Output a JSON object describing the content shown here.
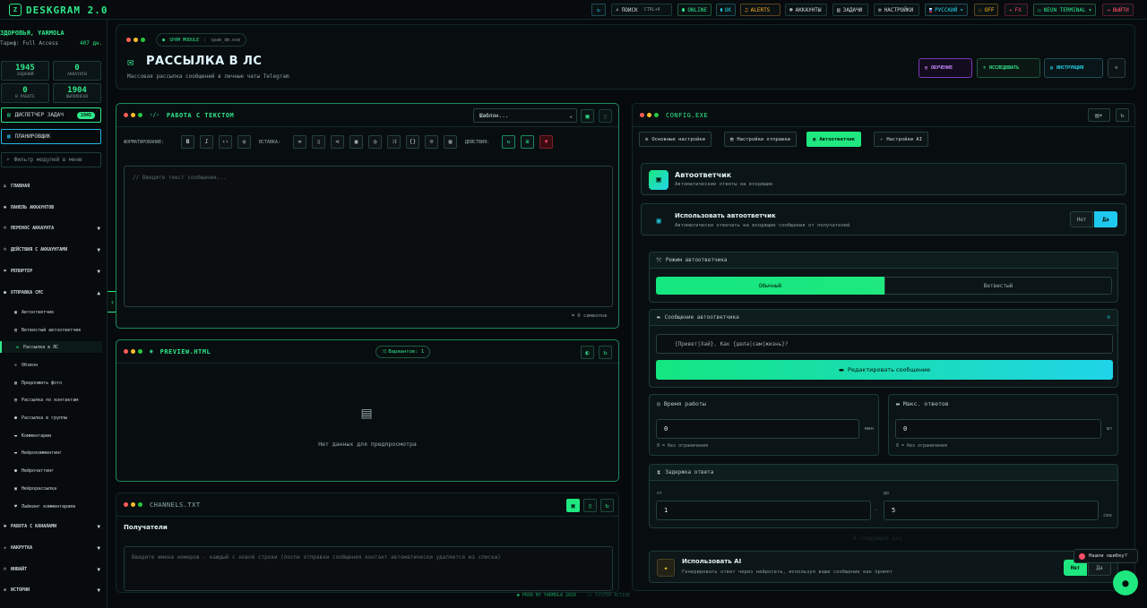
{
  "app": {
    "logo_glyph": "Z",
    "name": "DESKGRAM 2.0"
  },
  "topbar": {
    "search_label": "ПОИСК",
    "search_shortcut": "CTRL+K",
    "online_label": "ONLINE",
    "ok_label": "OK",
    "alerts_label": "ALERTS",
    "accounts_label": "АККАУНТЫ",
    "tasks_label": "ЗАДАЧИ",
    "settings_label": "НАСТРОЙКИ",
    "language_label": "РУССКИЙ",
    "off_label": "OFF",
    "fx_label": "FX",
    "theme_label": "NEON TERMINAL",
    "logout_label": "ВЫЙТИ"
  },
  "sidebar": {
    "greeting": "ЗДОРОВЬЯ, YARMOLA",
    "tariff": "Тариф: Full Access",
    "days_left": "407 дн.",
    "stats": [
      {
        "value": "1945",
        "label": "ЗАДАНИЙ"
      },
      {
        "value": "0",
        "label": "АККАУНТЫ"
      },
      {
        "value": "0",
        "label": "В РАБОТЕ"
      },
      {
        "value": "1904",
        "label": "ВЫПОЛНЕНО"
      }
    ],
    "dispatcher_label": "ДИСПЕТЧЕР ЗАДАЧ",
    "dispatcher_badge": "1945",
    "planner_label": "ПЛАНИРОВЩИК",
    "filter_placeholder": "Фильтр модулей в меню",
    "nav": [
      {
        "label": "ГЛАВНАЯ",
        "icon": "home-icon"
      },
      {
        "label": "ПАНЕЛЬ АККАУНТОВ",
        "icon": "users-icon"
      },
      {
        "label": "ПЕРЕНОС АККАУНТА",
        "icon": "user-transfer-icon"
      },
      {
        "label": "ДЕЙСТВИЯ С АККАУНТАМИ",
        "icon": "user-actions-icon"
      },
      {
        "label": "РЕПОРТЕР",
        "icon": "flag-icon"
      },
      {
        "label": "ОТПРАВКА СМС",
        "icon": "chat-icon"
      }
    ],
    "sms_items": [
      "Автоответчик",
      "Ветвистый автоответчик",
      "Рассылка в ЛС",
      "Обзвон",
      "Предложить фото",
      "Рассылка по контактам",
      "Рассылка в группы",
      "Комментарии",
      "Нейрокомментинг",
      "Нейрочаттинг",
      "Нейрорассылка",
      "Лайкинг комментариев"
    ],
    "nav_bottom": [
      {
        "label": "РАБОТА С КАНАЛАМИ",
        "icon": "channels-icon"
      },
      {
        "label": "НАКРУТКА",
        "icon": "chart-icon"
      },
      {
        "label": "ИНВАЙТ",
        "icon": "invite-icon"
      },
      {
        "label": "ИСТОРИИ",
        "icon": "stories-icon"
      }
    ]
  },
  "header": {
    "module_tag": "SPAM MODULE",
    "module_file": "spam_dm.exe",
    "title": "РАССЫЛКА В ЛС",
    "subtitle": "Массовая рассылка сообщений в личные чаты Telegram",
    "learn_label": "ОБУЧЕНИЕ",
    "research_label": "ИССЛЕДОВАТЬ",
    "guide_label": "ИНСТРУКЦИЯ"
  },
  "text_panel": {
    "title": "РАБОТА С ТЕКСТОМ",
    "template_select": "Шаблон...",
    "formatting_label": "ФОРМАТИРОВАНИЕ:",
    "insert_label": "ВСТАВКА:",
    "actions_label": "ДЕЙСТВИЯ:",
    "bold": "B",
    "italic": "I",
    "editor_placeholder": "// Введите текст сообщения...",
    "char_count": "0 символов"
  },
  "preview_panel": {
    "title": "PREVIEW.HTML",
    "variants": "Вариантов: 1",
    "empty_text": "Нет данных для предпросмотра"
  },
  "channels_panel": {
    "title": "CHANNELS.TXT",
    "recipients_label": "Получатели",
    "placeholder": "Введите имена номеров - каждый с новой строки (после отправки сообщения контакт автоматически удаляется из списка)"
  },
  "config": {
    "title": "CONFIG.EXE",
    "tabs": [
      "Основные настройки",
      "Настройки отправки",
      "Автоответчик",
      "Настройки AI"
    ],
    "active_tab": 2,
    "autoresponder_title": "Автоответчик",
    "autoresponder_desc": "Автоматические ответы на входящие",
    "use_label": "Использовать автоответчик",
    "use_desc": "Автоматически отвечать на входящие сообщения от получателей",
    "no_label": "Нет",
    "yes_label": "Да",
    "mode_title": "Режим автоответчика",
    "mode_normal": "Обычный",
    "mode_branchy": "Ветвистый",
    "message_title": "Сообщение автоответчика",
    "message_value": "{Привет|Хай}. Как {дела|сам|жизнь}?",
    "edit_button": "Редактировать сообщение",
    "work_time_title": "Время работы",
    "work_time_value": "0",
    "work_time_unit": "мин",
    "work_time_hint": "0 = без ограничения",
    "max_replies_title": "Макс. ответов",
    "max_replies_value": "0",
    "max_replies_unit": "шт",
    "max_replies_hint": "0 = без ограничения",
    "delay_title": "Задержка ответа",
    "from_label": "от",
    "to_label": "до",
    "delay_from": "1",
    "delay_to": "5",
    "delay_unit": "сек",
    "faded_text": "В следующий раз",
    "ai_title": "Использовать AI",
    "ai_desc": "Генерировать ответ через нейросеть, используя ваше сообщение как промпт",
    "ai_no": "Нет",
    "ai_yes": "Да"
  },
  "bug_label": "Нашли ошибку?",
  "footer": {
    "credit": "PROD BY YARMOLA 2026",
    "status": "// SYSTEM ACTIVE"
  },
  "colors": {
    "accent": "#2fe88a",
    "cyan": "#21d4e8",
    "danger": "#ff4d6a",
    "warning": "#ffb020"
  }
}
